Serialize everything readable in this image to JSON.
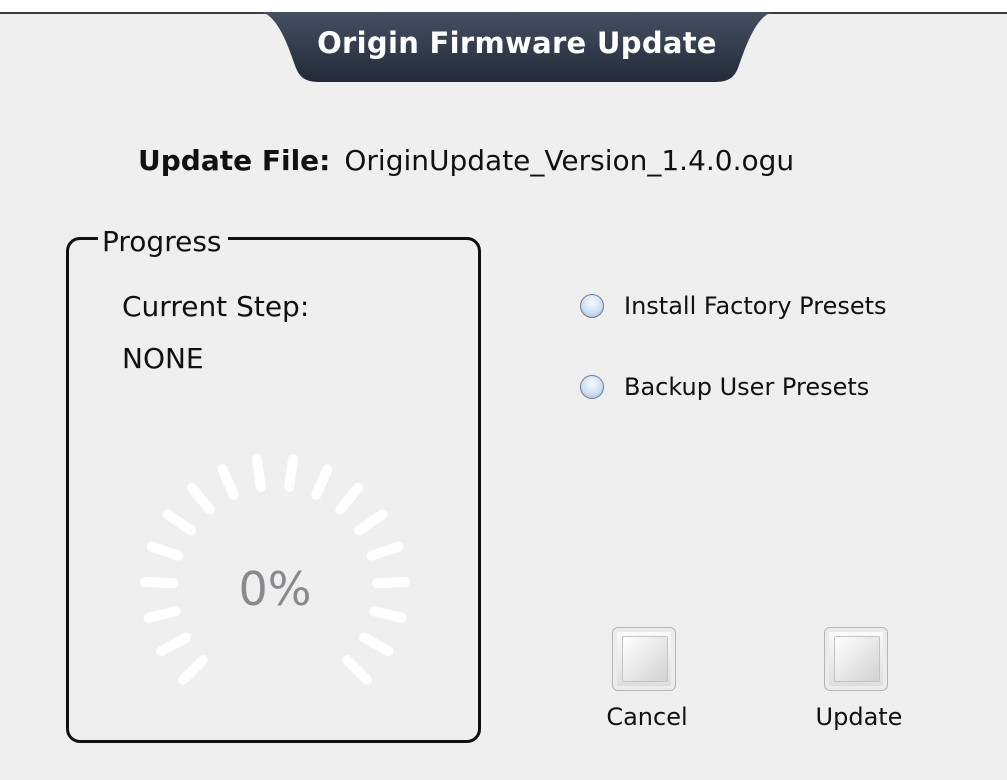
{
  "window": {
    "title": "Origin Firmware Update"
  },
  "update_file": {
    "label": "Update File:",
    "value": "OriginUpdate_Version_1.4.0.ogu"
  },
  "progress": {
    "legend": "Progress",
    "current_step_label": "Current Step:",
    "current_step_value": "NONE",
    "percent_text": "0%",
    "percent_value": 0
  },
  "options": {
    "install_factory_presets": "Install Factory Presets",
    "backup_user_presets": "Backup User Presets"
  },
  "buttons": {
    "cancel_label": "Cancel",
    "update_label": "Update"
  },
  "colors": {
    "title_tab": "#2c3546",
    "window_bg": "#f0eff0",
    "gauge_tick": "#ffffff",
    "percent_text": "#8a8a8e"
  }
}
